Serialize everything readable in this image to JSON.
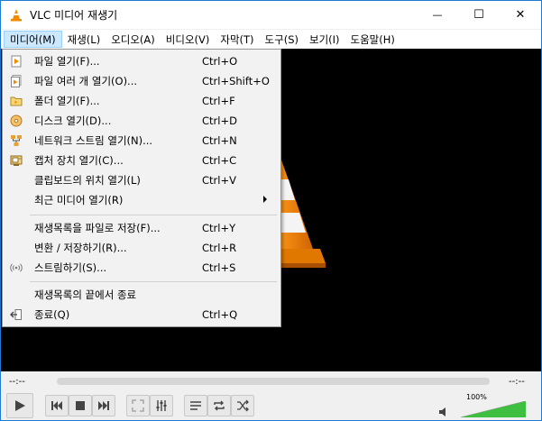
{
  "window": {
    "title": "VLC 미디어 재생기",
    "minimize_glyph": "—",
    "maximize_glyph": "☐",
    "close_glyph": "✕"
  },
  "menubar": {
    "items": [
      {
        "label": "미디어(M)",
        "active": true
      },
      {
        "label": "재생(L)"
      },
      {
        "label": "오디오(A)"
      },
      {
        "label": "비디오(V)"
      },
      {
        "label": "자막(T)"
      },
      {
        "label": "도구(S)"
      },
      {
        "label": "보기(I)"
      },
      {
        "label": "도움말(H)"
      }
    ]
  },
  "media_menu": {
    "items": [
      {
        "label": "파일 열기(F)...",
        "shortcut": "Ctrl+O",
        "icon": "file-open-icon"
      },
      {
        "label": "파일 여러 개 열기(O)...",
        "shortcut": "Ctrl+Shift+O",
        "icon": "multiple-files-icon"
      },
      {
        "label": "폴더 열기(F)...",
        "shortcut": "Ctrl+F",
        "icon": "folder-icon"
      },
      {
        "label": "디스크 열기(D)...",
        "shortcut": "Ctrl+D",
        "icon": "disc-icon"
      },
      {
        "label": "네트워크 스트림 열기(N)...",
        "shortcut": "Ctrl+N",
        "icon": "network-icon"
      },
      {
        "label": "캡처 장치 열기(C)...",
        "shortcut": "Ctrl+C",
        "icon": "capture-device-icon"
      },
      {
        "label": "클립보드의 위치 열기(L)",
        "shortcut": "Ctrl+V",
        "icon": ""
      },
      {
        "label": "최근 미디어 열기(R)",
        "shortcut": "",
        "icon": "",
        "submenu": true
      },
      {
        "label": "재생목록을 파일로 저장(F)...",
        "shortcut": "Ctrl+Y",
        "icon": ""
      },
      {
        "label": "변환 / 저장하기(R)...",
        "shortcut": "Ctrl+R",
        "icon": ""
      },
      {
        "label": "스트림하기(S)...",
        "shortcut": "Ctrl+S",
        "icon": "stream-icon"
      },
      {
        "label": "재생목록의 끝에서 종료",
        "shortcut": "",
        "icon": ""
      },
      {
        "label": "종료(Q)",
        "shortcut": "Ctrl+Q",
        "icon": "quit-icon"
      }
    ]
  },
  "player": {
    "elapsed": "--:--",
    "remaining": "--:--",
    "volume": "100%",
    "volume_level": 1.0
  },
  "colors": {
    "accent": "#1f7ad1",
    "menu_active_bg": "#cce8ff",
    "cone_orange": "#f08a00",
    "volume_green": "#3fbf3f"
  }
}
